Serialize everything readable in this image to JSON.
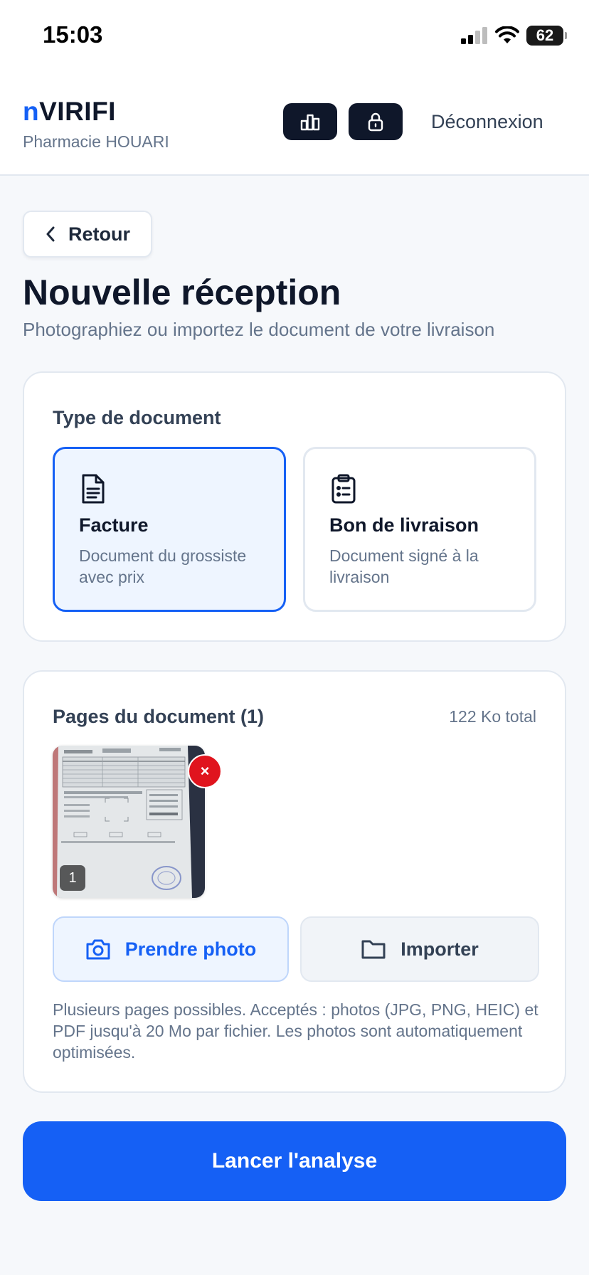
{
  "status_bar": {
    "time": "15:03",
    "battery": "62"
  },
  "header": {
    "brand_prefix": "n",
    "brand_rest": "VIRIFI",
    "pharmacy": "Pharmacie HOUARI",
    "stats_icon": "bar-chart-icon",
    "lock_icon": "lock-icon",
    "logout_label": "Déconnexion"
  },
  "nav": {
    "back_label": "Retour"
  },
  "page": {
    "title": "Nouvelle réception",
    "subtitle": "Photographiez ou importez le document de votre livraison"
  },
  "document_type": {
    "heading": "Type de document",
    "options": [
      {
        "title": "Facture",
        "description": "Document du grossiste avec prix",
        "icon": "invoice-document-icon",
        "selected": true
      },
      {
        "title": "Bon de livraison",
        "description": "Document signé à la livraison",
        "icon": "clipboard-list-icon",
        "selected": false
      }
    ]
  },
  "pages_section": {
    "heading": "Pages du document (1)",
    "total": "122 Ko total",
    "thumbnails": [
      {
        "number": "1",
        "remove_label": "×"
      }
    ],
    "take_photo_label": "Prendre photo",
    "import_label": "Importer",
    "help_text": "Plusieurs pages possibles. Acceptés : photos (JPG, PNG, HEIC) et PDF jusqu'à 20 Mo par fichier. Les photos sont automatiquement optimisées."
  },
  "analyze_label": "Lancer l'analyse",
  "colors": {
    "accent": "#1560f5",
    "dark": "#0f172a",
    "muted": "#64748b",
    "danger": "#e0141e"
  }
}
